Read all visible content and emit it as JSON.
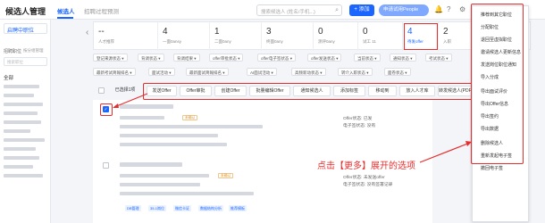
{
  "app": {
    "title": "候选人管理"
  },
  "tabs": [
    {
      "label": "候选人"
    },
    {
      "label": "招聘过程预测"
    }
  ],
  "header": {
    "search_placeholder": "搜索候选人 (姓名/手机...)",
    "add_label": "+ 添加",
    "people_label": "申请试用People"
  },
  "sidebar": {
    "job_select": "启聘中职位",
    "section_label": "招聘职位",
    "filter_label": "按分组管理",
    "search_placeholder": "搜索职位",
    "all_label": "全部"
  },
  "stages": [
    {
      "count": "--",
      "label": "人才推荐"
    },
    {
      "count": "4",
      "label": "一面0ansy"
    },
    {
      "count": "1",
      "label": "二面0any"
    },
    {
      "count": "3",
      "label": "终面0any"
    },
    {
      "count": "0",
      "label": "测评0any"
    },
    {
      "count": "0",
      "label": "试工 11"
    },
    {
      "count": "4",
      "label": "待发offer"
    },
    {
      "count": "2",
      "label": "入职"
    }
  ],
  "filter_chips_row1": [
    "登记来源状态",
    "背调状态",
    "背调结果",
    "offer审批状态",
    "offer电子签状态",
    "offer发送状态",
    "当前状态",
    "通知状态",
    "考试状态"
  ],
  "filter_chips_row2": [
    "最新考试简報排名",
    "面试活动",
    "最新面试简報排名",
    "AI面试活动",
    "高频新动状态",
    "转介入职状态",
    "面卷状态"
  ],
  "actions": {
    "select_all": "已选择1项",
    "buttons": [
      "发送Offer",
      "Offer审批",
      "创建Offer",
      "批量编辑Offer",
      "通知候选人",
      "添加标签",
      "移动到",
      "放入人才库",
      "转发候选人(PDF)"
    ]
  },
  "rows": [
    {
      "tag": "未确认",
      "offer_status": "Offer状态: 已发",
      "esign_status": "电子签状态: 没有"
    },
    {
      "tag": "未确认",
      "offer_status": "Offer状态: 未发送offer",
      "esign_status": "电子签状态: 没有签署记录"
    }
  ],
  "row_tags": [
    "DB管理",
    "35-1岗位",
    "微信卡证",
    "数据结构分析",
    "推荐模板"
  ],
  "dropdown": {
    "items": [
      "推荐到其它职位",
      "分配职位",
      "退回至虚拟职位",
      "邀请候选人更新信息",
      "发送岗位职位通知",
      "导入分成",
      "导出面试评价",
      "导出Offer信息",
      "导出签约",
      "导出数据",
      "删除候选人",
      "重新发起电子签",
      "撤回电子签"
    ]
  },
  "annotation": "点击【更多】展开的选项",
  "colors": {
    "accent": "#1a66ff",
    "highlight": "#e62e2e"
  }
}
